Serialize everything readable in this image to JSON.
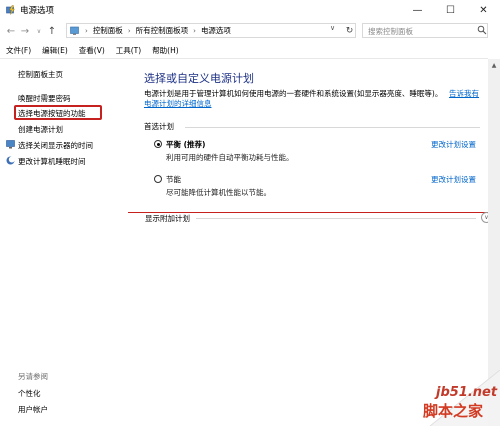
{
  "window": {
    "title": "电源选项",
    "minimize_glyph": "—",
    "maximize_glyph": "☐",
    "close_glyph": "✕"
  },
  "address_bar": {
    "breadcrumbs": [
      "控制面板",
      "所有控制面板项",
      "电源选项"
    ],
    "search_placeholder": "搜索控制面板"
  },
  "menu": [
    "文件(F)",
    "编辑(E)",
    "查看(V)",
    "工具(T)",
    "帮助(H)"
  ],
  "sidebar": {
    "home": "控制面板主页",
    "items": [
      "唤醒时需要密码",
      "选择电源按钮的功能",
      "创建电源计划",
      "选择关闭显示器的时间",
      "更改计算机睡眠时间"
    ],
    "see_also": "另请参阅",
    "see_also_items": [
      "个性化",
      "用户帐户"
    ]
  },
  "main": {
    "title": "选择或自定义电源计划",
    "description": "电源计划是用于管理计算机如何使用电源的一套硬件和系统设置(如显示器亮度、睡眠等)。",
    "link_more": "告诉我有",
    "link_details": "电源计划的详细信息",
    "preferred_plans_header": "首选计划",
    "plans": [
      {
        "name": "平衡 (推荐)",
        "description": "利用可用的硬件自动平衡功耗与性能。",
        "change_link": "更改计划设置",
        "selected": true
      },
      {
        "name": "节能",
        "description": "尽可能降低计算机性能以节能。",
        "change_link": "更改计划设置",
        "selected": false
      }
    ],
    "more_plans": "显示附加计划"
  },
  "watermark": {
    "domain": "jb51.net",
    "name": "脚本之家"
  },
  "colors": {
    "title_blue": "#1e3287",
    "link": "#0066cc",
    "highlight_red": "#c7211f"
  }
}
